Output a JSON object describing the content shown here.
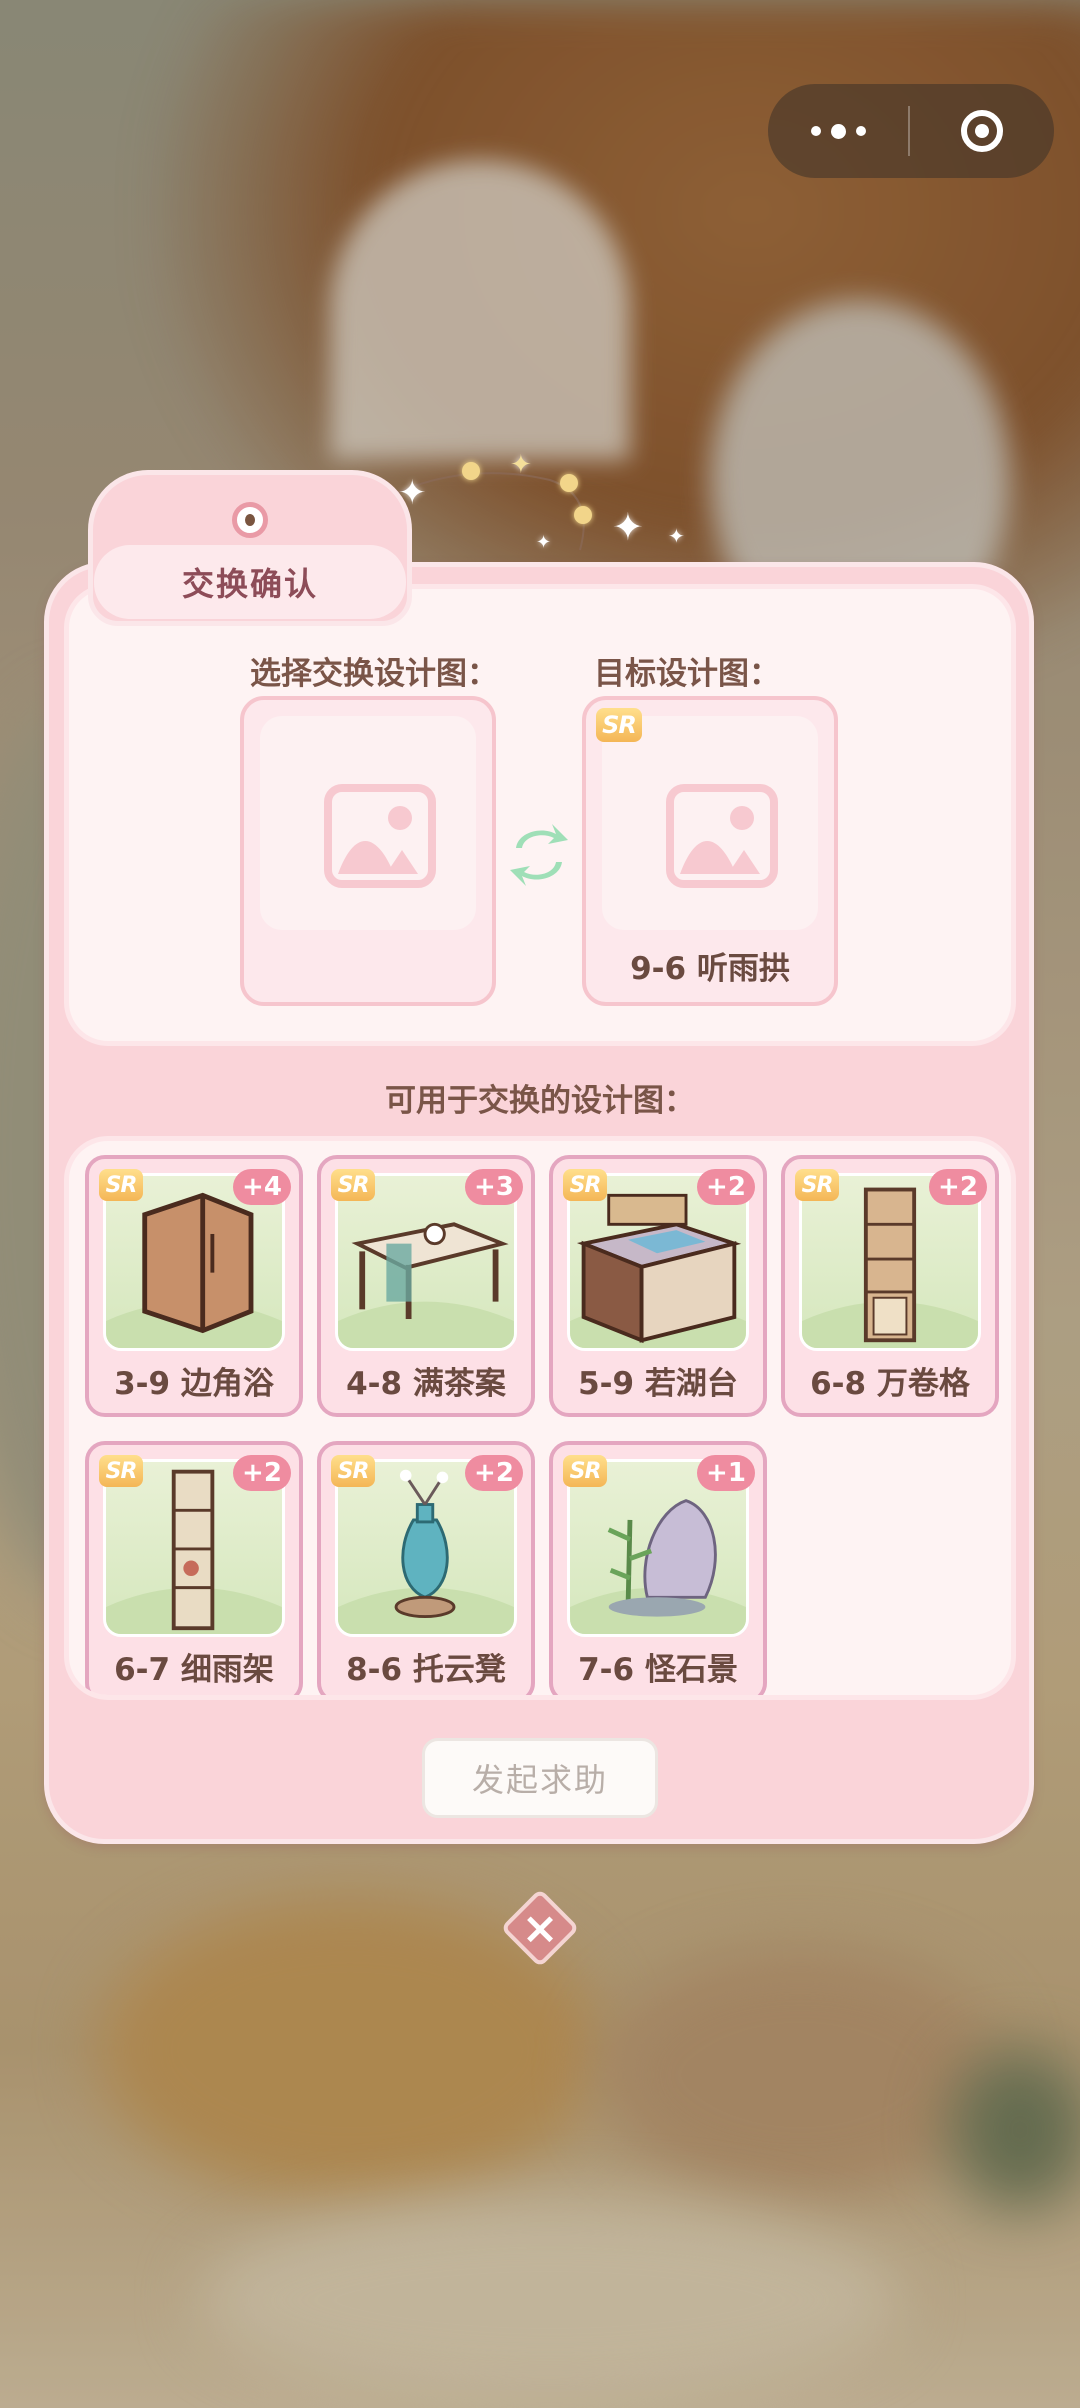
{
  "dialog": {
    "title": "交换确认",
    "select_label": "选择交换设计图：",
    "target_label": "目标设计图：",
    "target_item": {
      "rarity": "SR",
      "name": "9-6 听雨拱"
    },
    "available_label": "可用于交换的设计图：",
    "help_button": "发起求助",
    "close_icon": "close-icon"
  },
  "items": [
    {
      "rarity": "SR",
      "count": "+4",
      "name": "3-9 边角浴"
    },
    {
      "rarity": "SR",
      "count": "+3",
      "name": "4-8 满茶案"
    },
    {
      "rarity": "SR",
      "count": "+2",
      "name": "5-9 若湖台"
    },
    {
      "rarity": "SR",
      "count": "+2",
      "name": "6-8 万卷格"
    },
    {
      "rarity": "SR",
      "count": "+2",
      "name": "6-7 细雨架"
    },
    {
      "rarity": "SR",
      "count": "+2",
      "name": "8-6 托云凳"
    },
    {
      "rarity": "SR",
      "count": "+1",
      "name": "7-6 怪石景"
    }
  ],
  "capsule": {
    "more_icon": "more-dots-icon",
    "close_icon": "target-circle-icon"
  },
  "colors": {
    "panel": "#fad4d9",
    "accent": "#ef8ca0",
    "sr_badge": "#f4b656",
    "title_text": "#8d4c58"
  }
}
